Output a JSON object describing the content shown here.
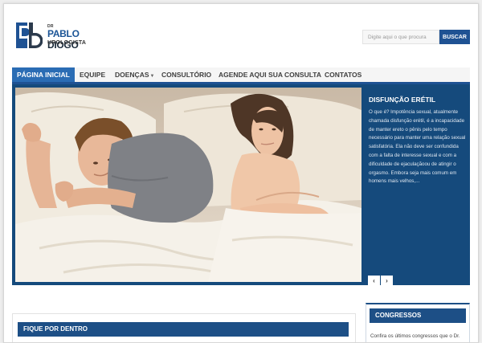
{
  "brand": {
    "monogram": "pb",
    "prefix": "DR",
    "first_name": "PABLO",
    "last_name": "DIOGO",
    "role": "UROLOGISTA"
  },
  "search": {
    "placeholder": "Digite aqui o que procura",
    "button_label": "BUSCAR"
  },
  "nav": {
    "items": [
      {
        "label": "PÁGINA INICIAL",
        "active": true
      },
      {
        "label": "EQUIPE"
      },
      {
        "label": "DOENÇAS",
        "has_dropdown": true
      },
      {
        "label": "CONSULTÓRIO"
      },
      {
        "label": "AGENDE AQUI SUA CONSULTA"
      },
      {
        "label": "CONTATOS"
      }
    ]
  },
  "slider": {
    "title": "DISFUNÇÃO ERÉTIL",
    "text": "O que é? Impotência sexual, atualmente chamada disfunção erétil, é a incapacidade de manter ereto o pênis pelo tempo necessário para manter uma relação sexual satisfatória. Ela não deve ser confundida com a falta de interesse sexual e com a dificuldade de ejaculaçãoou de atingir o orgasmo. Embora seja mais comum em homens mais velhos,...",
    "prev": "‹",
    "next": "›"
  },
  "sections": {
    "fique_title": "FIQUE POR DENTRO",
    "congressos_title": "CONGRESSOS",
    "congressos_text": "Confira os últimos congressos que o Dr."
  },
  "colors": {
    "brand_blue": "#1f5293",
    "nav_active": "#2a6cb4",
    "slider_panel": "#154a7c"
  }
}
